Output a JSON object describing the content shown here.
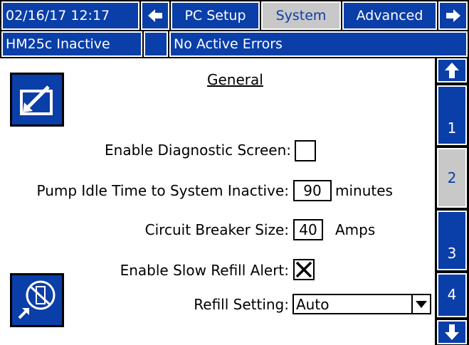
{
  "header": {
    "datetime": "02/16/17 12:17",
    "tabs": [
      {
        "label": "PC Setup",
        "active": false
      },
      {
        "label": "System",
        "active": true
      },
      {
        "label": "Advanced",
        "active": false
      }
    ],
    "nav_left_icon": "arrow-left-icon",
    "nav_right_icon": "arrow-right-icon"
  },
  "status": {
    "system_state": "HM25c Inactive",
    "indicator": "",
    "errors": "No Active Errors"
  },
  "page": {
    "title": "General",
    "fields": {
      "diagnostic_label": "Enable Diagnostic Screen:",
      "diagnostic_checked": false,
      "idle_label": "Pump Idle Time to System Inactive:",
      "idle_value": "90",
      "idle_unit": "minutes",
      "breaker_label": "Circuit Breaker Size:",
      "breaker_value": "40",
      "breaker_unit": "Amps",
      "slow_refill_label": "Enable Slow Refill Alert:",
      "slow_refill_checked": true,
      "refill_label": "Refill Setting:",
      "refill_value": "Auto"
    }
  },
  "side_nav": {
    "up_icon": "arrow-up-icon",
    "down_icon": "arrow-down-icon",
    "pages": [
      {
        "label": "1",
        "active": false
      },
      {
        "label": "2",
        "active": true
      },
      {
        "label": "3",
        "active": false
      },
      {
        "label": "4",
        "active": false
      }
    ]
  },
  "left_buttons": {
    "edit_icon": "edit-screen-icon",
    "maintenance_icon": "maintenance-icon"
  },
  "colors": {
    "primary_blue": "#0a3ea8",
    "active_gray": "#c8c8c8",
    "background": "#000000"
  }
}
